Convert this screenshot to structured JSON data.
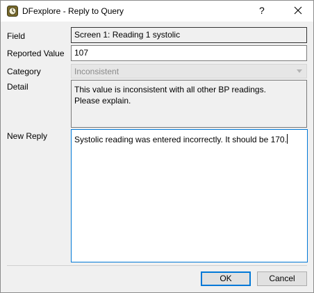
{
  "window": {
    "title": "DFexplore - Reply to Query",
    "help_label": "?"
  },
  "form": {
    "field_label": "Field",
    "field_value": "Screen 1: Reading 1 systolic",
    "reported_label": "Reported Value",
    "reported_value": "107",
    "category_label": "Category",
    "category_value": "Inconsistent",
    "detail_label": "Detail",
    "detail_line1": "This value is inconsistent with all other BP readings.",
    "detail_line2": "Please explain.",
    "reply_label": "New Reply",
    "reply_value": "Systolic reading was entered incorrectly. It should be 170."
  },
  "buttons": {
    "ok_label": "OK",
    "cancel_label": "Cancel"
  },
  "colors": {
    "accent": "#0078d7",
    "dialog_bg": "#f0f0f0",
    "disabled_text": "#8a8a8a"
  }
}
